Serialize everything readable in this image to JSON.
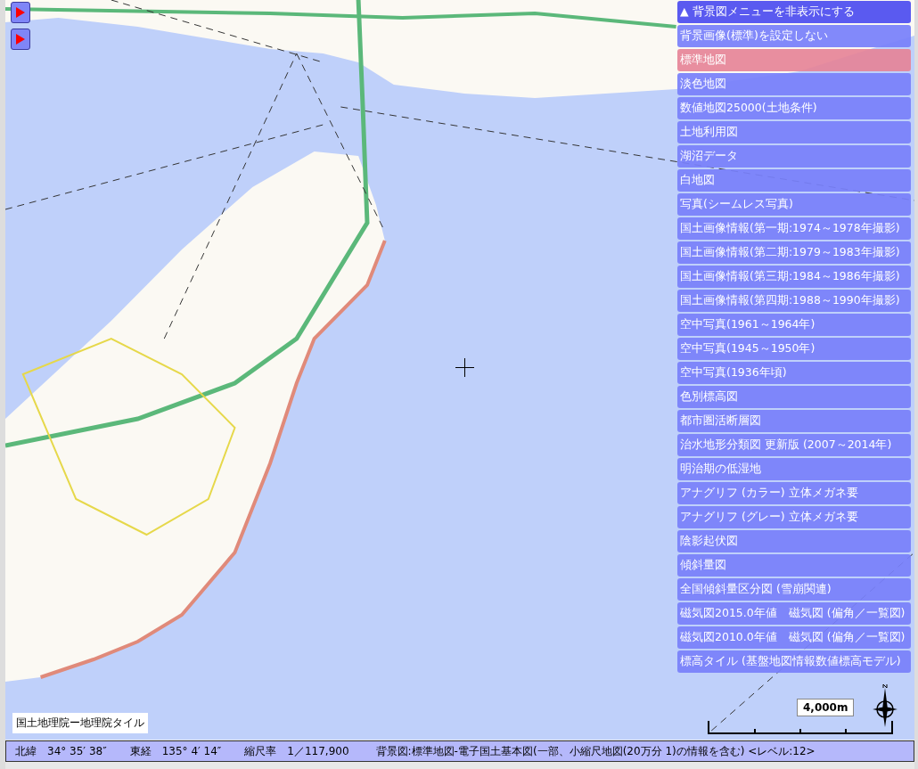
{
  "side_buttons": [
    {
      "kind": "play"
    },
    {
      "kind": "play"
    }
  ],
  "menu": {
    "toggle": {
      "icon": "▲",
      "label": "背景図メニューを非表示にする"
    },
    "items": [
      {
        "label": "背景画像(標準)を設定しない",
        "selected": false
      },
      {
        "label": "標準地図",
        "selected": true
      },
      {
        "label": "淡色地図",
        "selected": false
      },
      {
        "label": "数値地図25000(土地条件)",
        "selected": false
      },
      {
        "label": "土地利用図",
        "selected": false
      },
      {
        "label": "湖沼データ",
        "selected": false
      },
      {
        "label": "白地図",
        "selected": false
      },
      {
        "label": "写真(シームレス写真)",
        "selected": false
      },
      {
        "label": "国土画像情報(第一期:1974～1978年撮影)",
        "selected": false
      },
      {
        "label": "国土画像情報(第二期:1979～1983年撮影)",
        "selected": false
      },
      {
        "label": "国土画像情報(第三期:1984～1986年撮影)",
        "selected": false
      },
      {
        "label": "国土画像情報(第四期:1988～1990年撮影)",
        "selected": false
      },
      {
        "label": "空中写真(1961～1964年)",
        "selected": false
      },
      {
        "label": "空中写真(1945～1950年)",
        "selected": false
      },
      {
        "label": "空中写真(1936年頃)",
        "selected": false
      },
      {
        "label": "色別標高図",
        "selected": false
      },
      {
        "label": "都市圏活断層図",
        "selected": false
      },
      {
        "label": "治水地形分類図 更新版 (2007～2014年)",
        "selected": false
      },
      {
        "label": "明治期の低湿地",
        "selected": false
      },
      {
        "label": "アナグリフ (カラー) 立体メガネ要",
        "selected": false
      },
      {
        "label": "アナグリフ (グレー) 立体メガネ要",
        "selected": false
      },
      {
        "label": "陰影起伏図",
        "selected": false
      },
      {
        "label": "傾斜量図",
        "selected": false
      },
      {
        "label": "全国傾斜量区分図 (雪崩関連)",
        "selected": false
      },
      {
        "label": "磁気図2015.0年値　磁気図 (偏角／一覧図)",
        "selected": false
      },
      {
        "label": "磁気図2010.0年値　磁気図 (偏角／一覧図)",
        "selected": false
      },
      {
        "label": "標高タイル (基盤地図情報数値標高モデル)",
        "selected": false
      }
    ]
  },
  "attribution": "国土地理院ー地理院タイル",
  "scale_bar": {
    "label": "4,000m"
  },
  "status_bar": {
    "latitude": "北緯　34° 35′ 38″",
    "longitude": "東経　135° 4′ 14″",
    "scale": "縮尺率　1／117,900",
    "background": "背景図:標準地図-電子国土基本図(一部、小縮尺地図(20万分 1)の情報を含む)  <レベル:12>"
  }
}
